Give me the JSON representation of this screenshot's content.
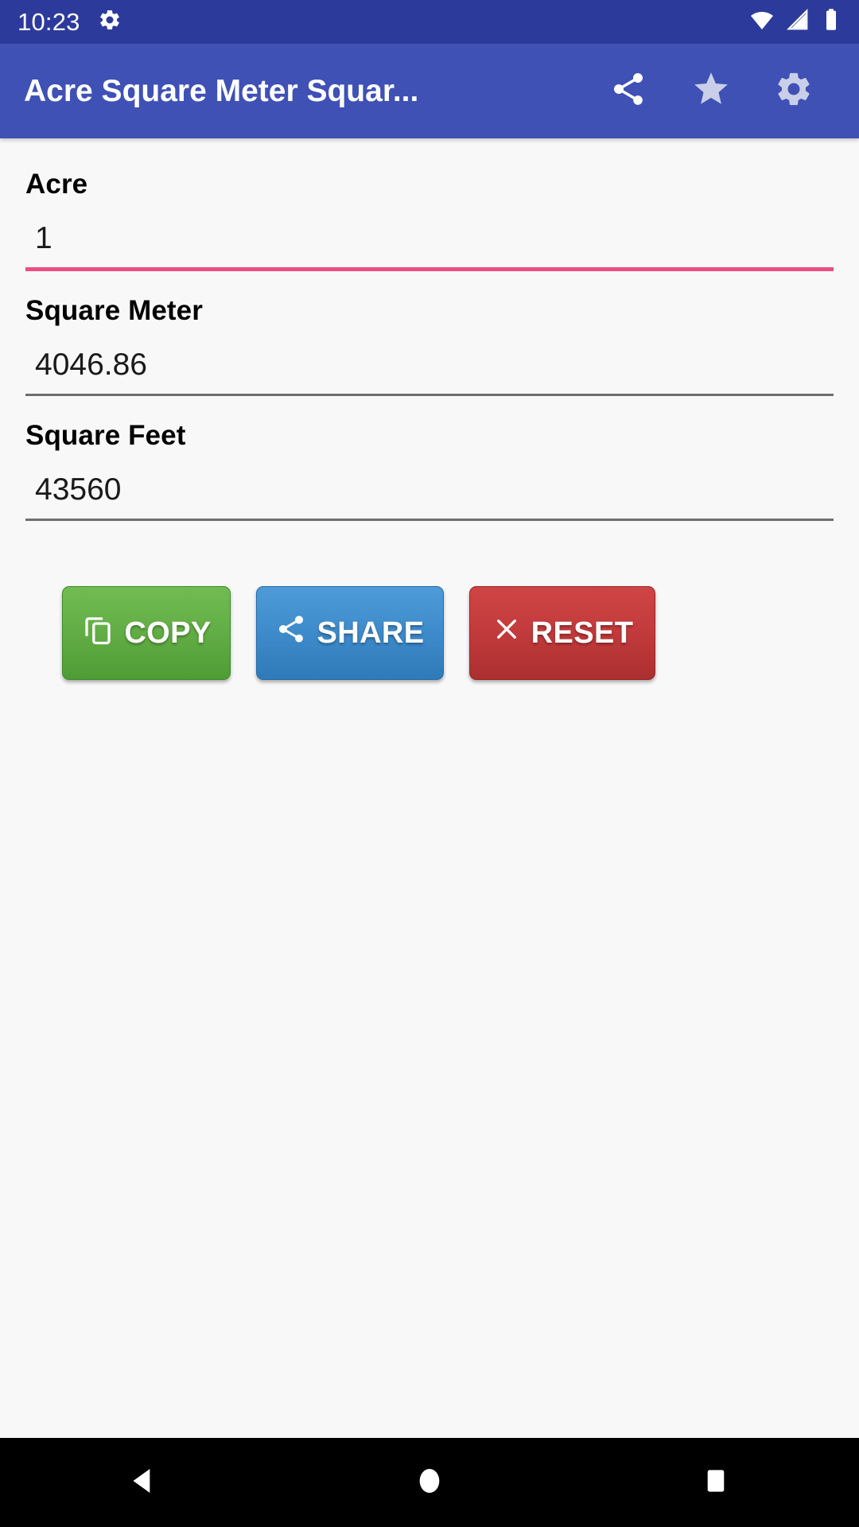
{
  "status_bar": {
    "clock": "10:23",
    "icons": [
      "gear-icon",
      "wifi-icon",
      "cellular-icon",
      "battery-icon"
    ],
    "background_color": "#2c3b9b"
  },
  "app_bar": {
    "title": "Acre Square Meter Squar...",
    "background_color": "#3f51b5",
    "actions": [
      {
        "name": "share-icon",
        "label": "Share"
      },
      {
        "name": "star-icon",
        "label": "Favorite"
      },
      {
        "name": "gear-icon",
        "label": "Settings"
      }
    ]
  },
  "form": {
    "fields": [
      {
        "label": "Acre",
        "value": "1",
        "placeholder": "",
        "active": true,
        "underline_color": "#ee4d84"
      },
      {
        "label": "Square Meter",
        "value": "4046.86",
        "placeholder": "",
        "active": false,
        "underline_color": "#6e6e6e"
      },
      {
        "label": "Square Feet",
        "value": "43560",
        "placeholder": "",
        "active": false,
        "underline_color": "#6e6e6e"
      }
    ]
  },
  "buttons": [
    {
      "label": "COPY",
      "icon": "copy-icon",
      "color": "#62ad45"
    },
    {
      "label": "SHARE",
      "icon": "share-icon",
      "color": "#3e8bcb"
    },
    {
      "label": "RESET",
      "icon": "close-icon",
      "color": "#c23a3b"
    }
  ],
  "nav_bar": {
    "background_color": "#000000",
    "items": [
      {
        "name": "back-button",
        "label": "Back"
      },
      {
        "name": "home-button",
        "label": "Home"
      },
      {
        "name": "recents-button",
        "label": "Recents"
      }
    ]
  }
}
